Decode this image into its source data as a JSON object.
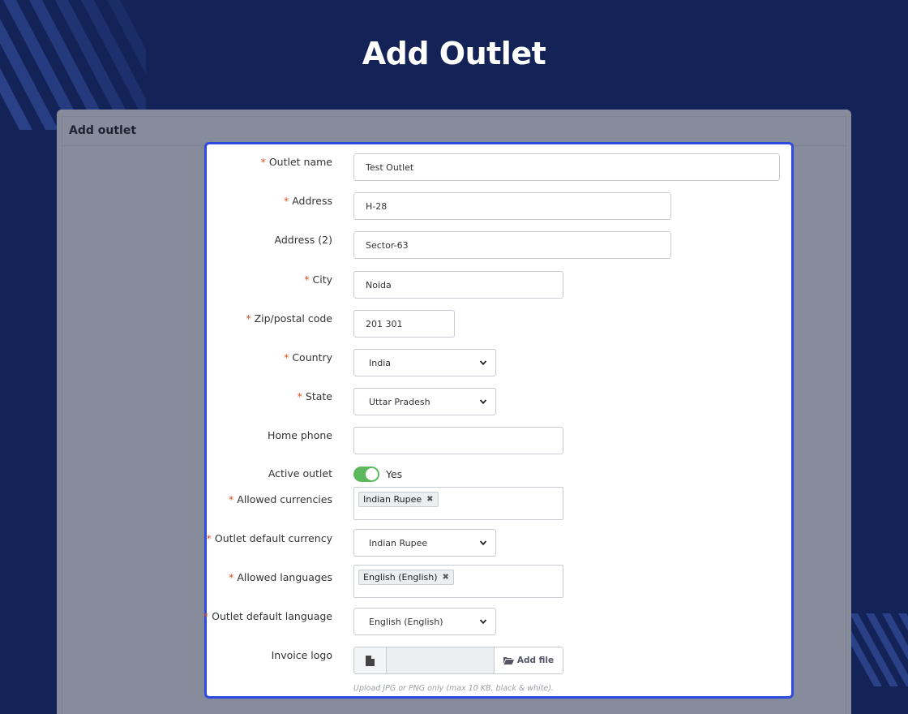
{
  "page": {
    "title": "Add Outlet"
  },
  "panel": {
    "header": "Add outlet"
  },
  "form": {
    "outlet_name": {
      "label": "Outlet name",
      "value": "Test Outlet"
    },
    "address": {
      "label": "Address",
      "value": "H-28"
    },
    "address2": {
      "label": "Address (2)",
      "value": "Sector-63"
    },
    "city": {
      "label": "City",
      "value": "Noida"
    },
    "zip": {
      "label": "Zip/postal code",
      "value": "201 301"
    },
    "country": {
      "label": "Country",
      "value": "India"
    },
    "state": {
      "label": "State",
      "value": "Uttar Pradesh"
    },
    "home_phone": {
      "label": "Home phone",
      "value": ""
    },
    "active_outlet": {
      "label": "Active outlet",
      "value": "Yes",
      "on": true
    },
    "allowed_currencies": {
      "label": "Allowed currencies",
      "tags": [
        "Indian Rupee"
      ]
    },
    "default_currency": {
      "label": "Outlet default currency",
      "value": "Indian Rupee"
    },
    "allowed_languages": {
      "label": "Allowed languages",
      "tags": [
        "English (English)"
      ]
    },
    "default_language": {
      "label": "Outlet default language",
      "value": "English (English)"
    },
    "invoice_logo": {
      "label": "Invoice logo",
      "button": "Add file",
      "hint": "Upload JPG or PNG only (max 10 KB, black & white)."
    }
  },
  "colors": {
    "background": "#132257",
    "accent": "#2d4be0",
    "required": "#d9531e",
    "toggle_on": "#5cb85c"
  },
  "icons": {
    "chevron": "chevron-down-icon",
    "file": "file-icon",
    "folder": "folder-open-icon",
    "remove": "close-icon"
  }
}
